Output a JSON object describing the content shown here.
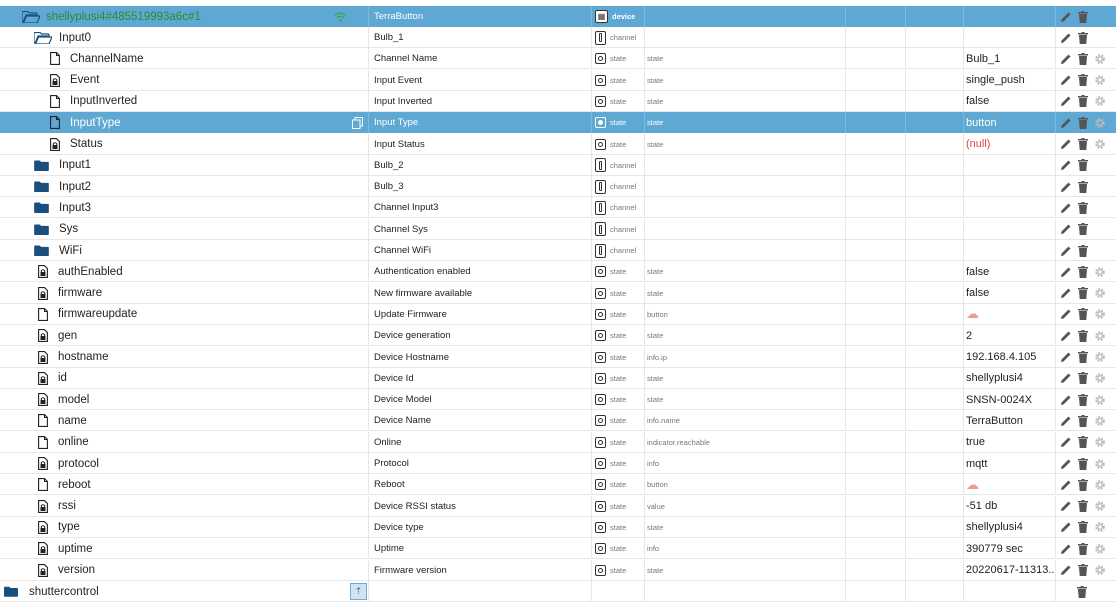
{
  "colors": {
    "selection": "#5fa8d3",
    "folder": "#1a4e7e",
    "null_value": "#e04444",
    "wifi": "#2bb14a",
    "device_id_text": "#2e8b2e"
  },
  "device": {
    "id": "shellyplusi4#485519993a6c#1",
    "name": "TerraButton",
    "type": "device"
  },
  "rows": [
    {
      "id": "Input0",
      "name": "Bulb_1",
      "type": "channel",
      "role": "",
      "value": ""
    },
    {
      "id": "ChannelName",
      "name": "Channel Name",
      "type": "state",
      "role": "state",
      "value": "Bulb_1"
    },
    {
      "id": "Event",
      "name": "Input Event",
      "type": "state",
      "role": "state",
      "value": "single_push"
    },
    {
      "id": "InputInverted",
      "name": "Input Inverted",
      "type": "state",
      "role": "state",
      "value": "false"
    },
    {
      "id": "InputType",
      "name": "Input Type",
      "type": "state",
      "role": "state",
      "value": "button"
    },
    {
      "id": "Status",
      "name": "Input Status",
      "type": "state",
      "role": "state",
      "value": "(null)"
    },
    {
      "id": "Input1",
      "name": "Bulb_2",
      "type": "channel",
      "role": "",
      "value": ""
    },
    {
      "id": "Input2",
      "name": "Bulb_3",
      "type": "channel",
      "role": "",
      "value": ""
    },
    {
      "id": "Input3",
      "name": "Channel Input3",
      "type": "channel",
      "role": "",
      "value": ""
    },
    {
      "id": "Sys",
      "name": "Channel Sys",
      "type": "channel",
      "role": "",
      "value": ""
    },
    {
      "id": "WiFi",
      "name": "Channel WiFi",
      "type": "channel",
      "role": "",
      "value": ""
    },
    {
      "id": "authEnabled",
      "name": "Authentication enabled",
      "type": "state",
      "role": "state",
      "value": "false"
    },
    {
      "id": "firmware",
      "name": "New firmware available",
      "type": "state",
      "role": "state",
      "value": "false"
    },
    {
      "id": "firmwareupdate",
      "name": "Update Firmware",
      "type": "state",
      "role": "button",
      "value": ""
    },
    {
      "id": "gen",
      "name": "Device generation",
      "type": "state",
      "role": "state",
      "value": "2"
    },
    {
      "id": "hostname",
      "name": "Device Hostname",
      "type": "state",
      "role": "info.ip",
      "value": "192.168.4.105"
    },
    {
      "id": "id",
      "name": "Device Id",
      "type": "state",
      "role": "state",
      "value": "shellyplusi4"
    },
    {
      "id": "model",
      "name": "Device Model",
      "type": "state",
      "role": "state",
      "value": "SNSN-0024X"
    },
    {
      "id": "name",
      "name": "Device Name",
      "type": "state",
      "role": "info.name",
      "value": "TerraButton"
    },
    {
      "id": "online",
      "name": "Online",
      "type": "state",
      "role": "indicator.reachable",
      "value": "true"
    },
    {
      "id": "protocol",
      "name": "Protocol",
      "type": "state",
      "role": "info",
      "value": "mqtt"
    },
    {
      "id": "reboot",
      "name": "Reboot",
      "type": "state",
      "role": "button",
      "value": ""
    },
    {
      "id": "rssi",
      "name": "Device RSSI status",
      "type": "state",
      "role": "value",
      "value": "-51 db"
    },
    {
      "id": "type",
      "name": "Device type",
      "type": "state",
      "role": "state",
      "value": "shellyplusi4"
    },
    {
      "id": "uptime",
      "name": "Uptime",
      "type": "state",
      "role": "info",
      "value": "390779 sec"
    },
    {
      "id": "version",
      "name": "Firmware version",
      "type": "state",
      "role": "state",
      "value": "20220617-11313..."
    }
  ],
  "next_folder": {
    "id": "shuttercontrol"
  }
}
